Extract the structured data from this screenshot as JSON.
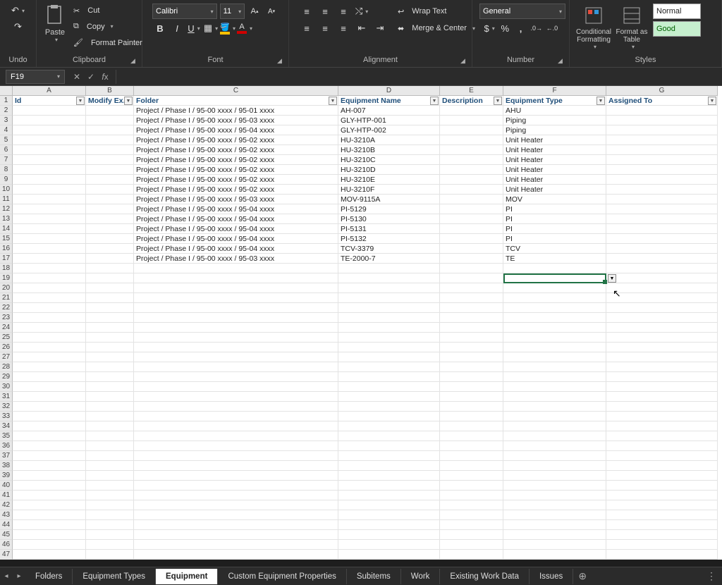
{
  "ribbon": {
    "undo_label": "Undo",
    "clipboard": {
      "label": "Clipboard",
      "paste": "Paste",
      "cut": "Cut",
      "copy": "Copy",
      "fmtpaint": "Format Painter"
    },
    "font": {
      "label": "Font",
      "name": "Calibri",
      "size": "11"
    },
    "alignment": {
      "label": "Alignment",
      "wrap": "Wrap Text",
      "merge": "Merge & Center"
    },
    "number": {
      "label": "Number",
      "format": "General"
    },
    "styles": {
      "label": "Styles",
      "cond": "Conditional Formatting",
      "table": "Format as Table",
      "normal": "Normal",
      "good": "Good"
    }
  },
  "namebox": "F19",
  "columns": [
    "A",
    "B",
    "C",
    "D",
    "E",
    "F",
    "G"
  ],
  "col_headers": {
    "A": "Id",
    "B": "Modify Ex.",
    "C": "Folder",
    "D": "Equipment Name",
    "E": "Description",
    "F": "Equipment Type",
    "G": "Assigned To"
  },
  "rows": [
    {
      "C": "Project / Phase I / 95-00 xxxx / 95-01 xxxx",
      "D": "AH-007",
      "F": "AHU"
    },
    {
      "C": "Project / Phase I / 95-00 xxxx / 95-03 xxxx",
      "D": "GLY-HTP-001",
      "F": "Piping"
    },
    {
      "C": "Project / Phase I / 95-00 xxxx / 95-04 xxxx",
      "D": "GLY-HTP-002",
      "F": "Piping"
    },
    {
      "C": "Project / Phase I / 95-00 xxxx / 95-02 xxxx",
      "D": "HU-3210A",
      "F": "Unit Heater"
    },
    {
      "C": "Project / Phase I / 95-00 xxxx / 95-02 xxxx",
      "D": "HU-3210B",
      "F": "Unit Heater"
    },
    {
      "C": "Project / Phase I / 95-00 xxxx / 95-02 xxxx",
      "D": "HU-3210C",
      "F": "Unit Heater"
    },
    {
      "C": "Project / Phase I / 95-00 xxxx / 95-02 xxxx",
      "D": "HU-3210D",
      "F": "Unit Heater"
    },
    {
      "C": "Project / Phase I / 95-00 xxxx / 95-02 xxxx",
      "D": "HU-3210E",
      "F": "Unit Heater"
    },
    {
      "C": "Project / Phase I / 95-00 xxxx / 95-02 xxxx",
      "D": "HU-3210F",
      "F": "Unit Heater"
    },
    {
      "C": "Project / Phase I / 95-00 xxxx / 95-03 xxxx",
      "D": "MOV-9115A",
      "F": "MOV"
    },
    {
      "C": "Project / Phase I / 95-00 xxxx / 95-04 xxxx",
      "D": "PI-5129",
      "F": "PI"
    },
    {
      "C": "Project / Phase I / 95-00 xxxx / 95-04 xxxx",
      "D": "PI-5130",
      "F": "PI"
    },
    {
      "C": "Project / Phase I / 95-00 xxxx / 95-04 xxxx",
      "D": "PI-5131",
      "F": "PI"
    },
    {
      "C": "Project / Phase I / 95-00 xxxx / 95-04 xxxx",
      "D": "PI-5132",
      "F": "PI"
    },
    {
      "C": "Project / Phase I / 95-00 xxxx / 95-04 xxxx",
      "D": "TCV-3379",
      "F": "TCV"
    },
    {
      "C": "Project / Phase I / 95-00 xxxx / 95-03 xxxx",
      "D": "TE-2000-7",
      "F": "TE"
    }
  ],
  "total_row_headers": 47,
  "tabs": [
    "Folders",
    "Equipment Types",
    "Equipment",
    "Custom Equipment Properties",
    "Subitems",
    "Work",
    "Existing Work Data",
    "Issues"
  ],
  "active_tab": "Equipment"
}
